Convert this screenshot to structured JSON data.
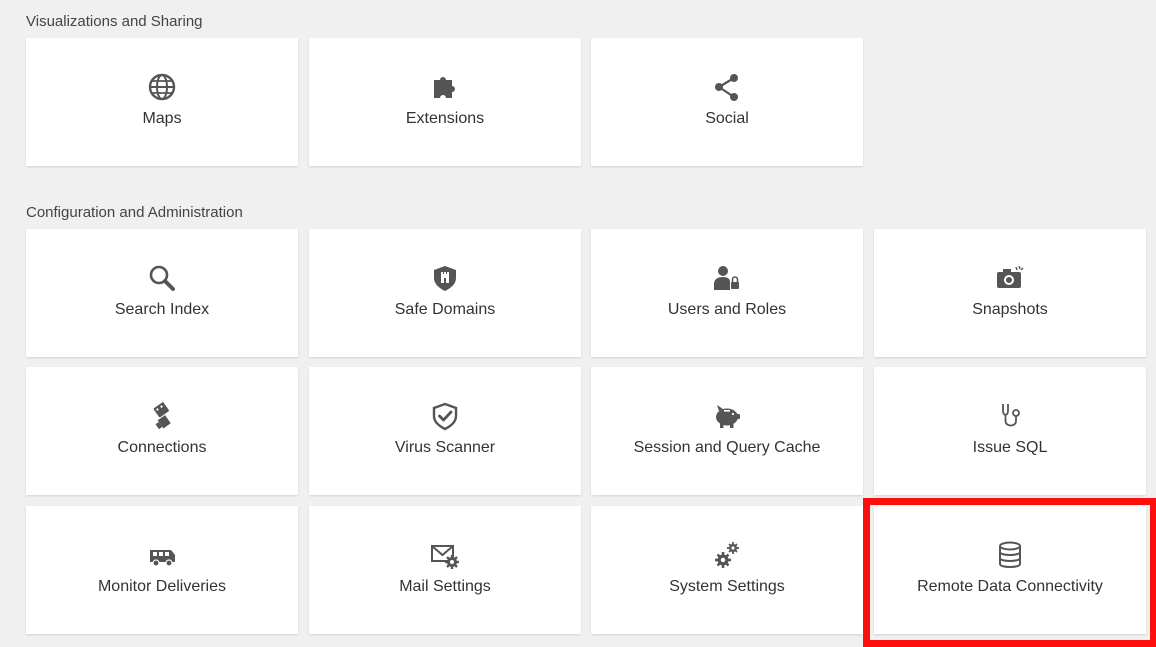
{
  "sections": [
    {
      "title": "Visualizations and Sharing",
      "tiles": [
        {
          "label": "Maps",
          "icon": "globe-icon"
        },
        {
          "label": "Extensions",
          "icon": "puzzle-icon"
        },
        {
          "label": "Social",
          "icon": "share-icon"
        }
      ]
    },
    {
      "title": "Configuration and Administration",
      "tiles": [
        {
          "label": "Search Index",
          "icon": "search-icon"
        },
        {
          "label": "Safe Domains",
          "icon": "castle-shield-icon"
        },
        {
          "label": "Users and Roles",
          "icon": "user-lock-icon"
        },
        {
          "label": "Snapshots",
          "icon": "camera-icon"
        },
        {
          "label": "Connections",
          "icon": "plug-icon"
        },
        {
          "label": "Virus Scanner",
          "icon": "shield-check-icon"
        },
        {
          "label": "Session and Query Cache",
          "icon": "piggy-bank-icon"
        },
        {
          "label": "Issue SQL",
          "icon": "stethoscope-icon"
        },
        {
          "label": "Monitor Deliveries",
          "icon": "truck-icon"
        },
        {
          "label": "Mail Settings",
          "icon": "mail-gear-icon"
        },
        {
          "label": "System Settings",
          "icon": "gears-icon"
        },
        {
          "label": "Remote Data Connectivity",
          "icon": "database-icon"
        }
      ]
    }
  ],
  "colors": {
    "background": "#f0f0f0",
    "tile": "#ffffff",
    "icon": "#555555",
    "highlight": "#ff0e0e"
  }
}
